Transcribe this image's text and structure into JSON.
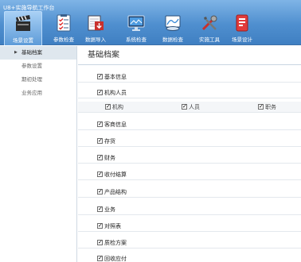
{
  "window": {
    "title": "U8+实施导航工作台"
  },
  "toolbar": {
    "items": [
      {
        "label": "场景设置",
        "icon": "clapperboard-icon"
      },
      {
        "label": "参数检查",
        "icon": "checklist-icon"
      },
      {
        "label": "数据导入",
        "icon": "data-import-icon"
      },
      {
        "label": "系统检查",
        "icon": "monitor-icon"
      },
      {
        "label": "数据检查",
        "icon": "data-check-icon"
      },
      {
        "label": "实施工具",
        "icon": "tools-icon"
      },
      {
        "label": "场景设计",
        "icon": "scene-design-icon"
      }
    ]
  },
  "sidebar": {
    "items": [
      {
        "label": "基础档案"
      },
      {
        "label": "参数设置"
      },
      {
        "label": "期初处理"
      },
      {
        "label": "业务应用"
      }
    ]
  },
  "main": {
    "title": "基础档案",
    "check_mark": "✓",
    "rows": [
      {
        "label": "基本信息",
        "checked": true
      },
      {
        "label": "机构人员",
        "checked": true
      },
      {
        "label": "客商信息",
        "checked": true
      },
      {
        "label": "存货",
        "checked": true
      },
      {
        "label": "财务",
        "checked": true
      },
      {
        "label": "收付结算",
        "checked": true
      },
      {
        "label": "产品结构",
        "checked": true
      },
      {
        "label": "业务",
        "checked": true
      },
      {
        "label": "对照表",
        "checked": true
      },
      {
        "label": "质检方案",
        "checked": true
      },
      {
        "label": "回收应付",
        "checked": true
      }
    ],
    "subrow": [
      {
        "label": "机构",
        "checked": true
      },
      {
        "label": "人员",
        "checked": true
      },
      {
        "label": "职务",
        "checked": true
      }
    ]
  }
}
